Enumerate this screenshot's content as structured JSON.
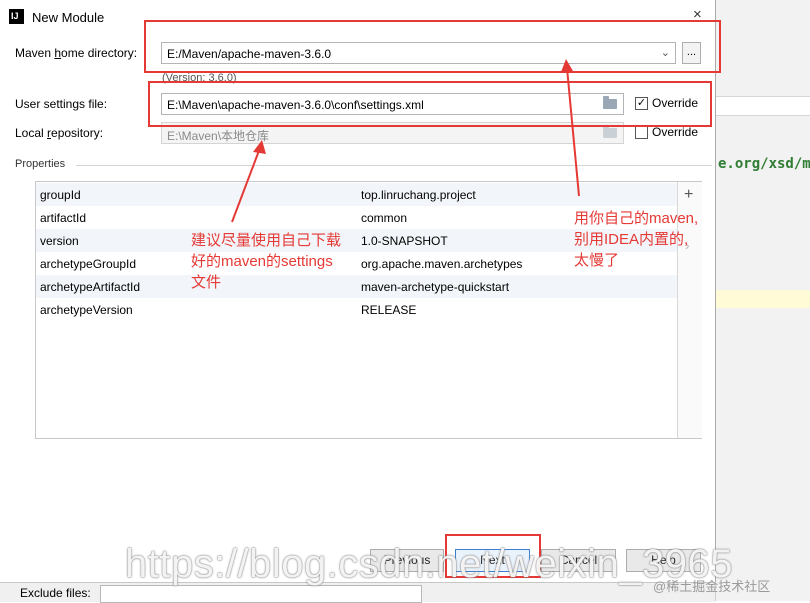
{
  "dialog": {
    "title": "New Module",
    "close": "×"
  },
  "maven_home": {
    "label_pre": "Maven ",
    "label_u": "h",
    "label_post": "ome directory:",
    "value": "E:/Maven/apache-maven-3.6.0",
    "browse": "...",
    "version": "(Version: 3.6.0)"
  },
  "user_settings": {
    "label": "User settings file:",
    "value": "E:\\Maven\\apache-maven-3.6.0\\conf\\settings.xml",
    "override_label": "Override",
    "override_checked": "✓"
  },
  "local_repo": {
    "label_pre": "Local ",
    "label_u": "r",
    "label_post": "epository:",
    "value": "E:\\Maven\\本地仓库",
    "override_label": "Override"
  },
  "properties": {
    "label": "Properties",
    "rows": [
      {
        "key": "groupId",
        "value": "top.linruchang.project"
      },
      {
        "key": "artifactId",
        "value": "common"
      },
      {
        "key": "version",
        "value": "1.0-SNAPSHOT"
      },
      {
        "key": "archetypeGroupId",
        "value": "org.apache.maven.archetypes"
      },
      {
        "key": "archetypeArtifactId",
        "value": "maven-archetype-quickstart"
      },
      {
        "key": "archetypeVersion",
        "value": "RELEASE"
      }
    ],
    "add": "+"
  },
  "buttons": {
    "previous": "Previous",
    "next": "Next",
    "cancel": "Cancel",
    "help": "Help"
  },
  "background": {
    "code_fragment": "e.org/xsd/m",
    "exclude_label": "Exclude files:"
  },
  "annotations": {
    "left_line1": "建议尽量使用自己下载",
    "left_line2": "好的maven的settings",
    "left_line3": "文件",
    "right_line1": "用你自己的maven,",
    "right_line2": "别用IDEA内置的,",
    "right_line3": "太慢了"
  },
  "watermark": "https://blog.csdn.net/weixin_3965",
  "credit": "@稀土掘金技术社区",
  "colors": {
    "annotation_red": "#e53935",
    "primary_button_border": "#3c7fd1"
  }
}
